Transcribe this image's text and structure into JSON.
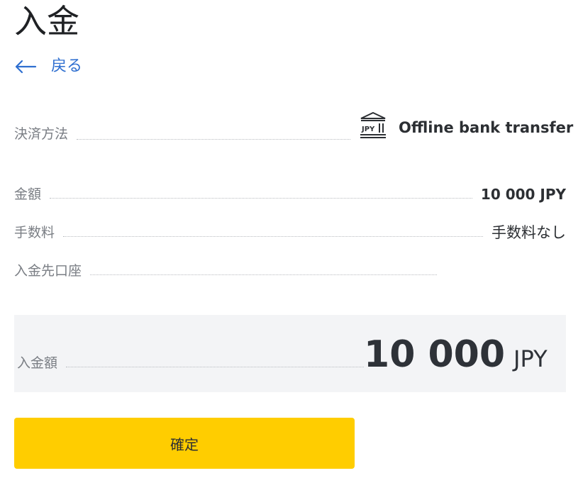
{
  "page": {
    "title": "入金"
  },
  "back": {
    "label": "戻る"
  },
  "method": {
    "label": "決済方法",
    "icon_text": "JPY",
    "value": "Offline bank transfer"
  },
  "amount": {
    "label": "金額",
    "value": "10 000 JPY"
  },
  "fee": {
    "label": "手数料",
    "value": "手数料なし"
  },
  "account": {
    "label": "入金先口座"
  },
  "total": {
    "label": "入金額",
    "amount": "10 000",
    "currency": "JPY"
  },
  "confirm": {
    "label": "確定"
  },
  "colors": {
    "accent": "#ffcd00",
    "link": "#2f6fd0",
    "panel": "#f3f4f6"
  }
}
